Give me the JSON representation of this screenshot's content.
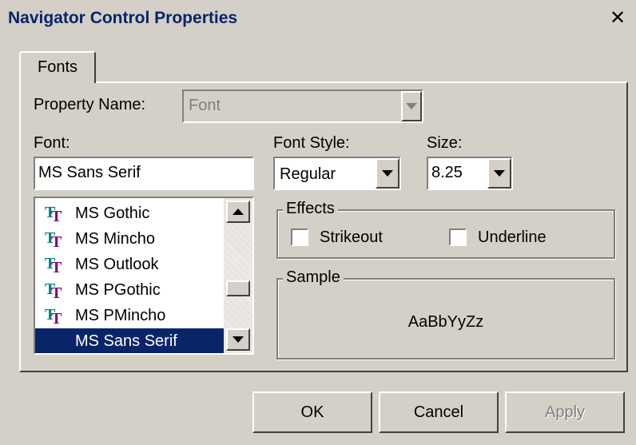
{
  "window": {
    "title": "Navigator Control Properties",
    "close_glyph": "✕"
  },
  "tabs": [
    {
      "label": "Fonts",
      "active": true
    }
  ],
  "property_name": {
    "label": "Property Name:",
    "value": "Font",
    "disabled": true
  },
  "font": {
    "label": "Font:",
    "value": "MS Sans Serif",
    "list": [
      {
        "label": "MS Gothic",
        "icon": "truetype-icon",
        "selected": false
      },
      {
        "label": "MS Mincho",
        "icon": "truetype-icon",
        "selected": false
      },
      {
        "label": "MS Outlook",
        "icon": "truetype-icon",
        "selected": false
      },
      {
        "label": "MS PGothic",
        "icon": "truetype-icon",
        "selected": false
      },
      {
        "label": "MS PMincho",
        "icon": "truetype-icon",
        "selected": false
      },
      {
        "label": "MS Sans Serif",
        "icon": "",
        "selected": true
      }
    ]
  },
  "font_style": {
    "label": "Font Style:",
    "value": "Regular"
  },
  "size": {
    "label": "Size:",
    "value": "8.25"
  },
  "effects": {
    "label": "Effects",
    "strikeout": {
      "label": "Strikeout",
      "checked": false
    },
    "underline": {
      "label": "Underline",
      "checked": false
    }
  },
  "sample": {
    "label": "Sample",
    "text": "AaBbYyZz"
  },
  "buttons": {
    "ok": "OK",
    "cancel": "Cancel",
    "apply": "Apply"
  },
  "colors": {
    "face": "#d4d0c8",
    "selection": "#0a246a",
    "title_text": "#0a246a",
    "icon_teal": "#008080",
    "icon_purple": "#800080"
  }
}
